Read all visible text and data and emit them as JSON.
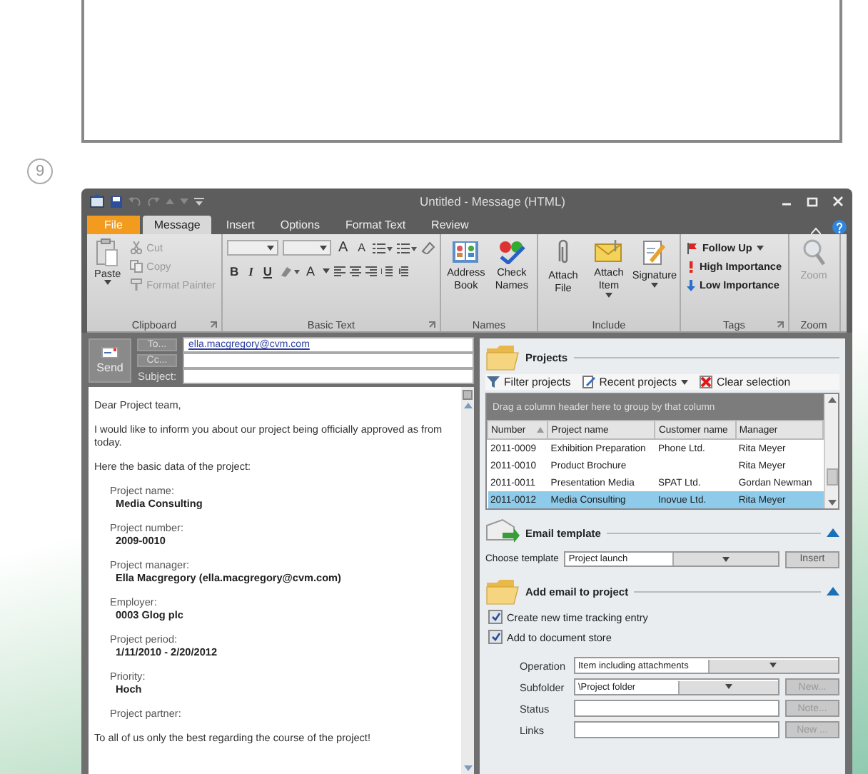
{
  "page": {
    "step_number": "9"
  },
  "window": {
    "title": "Untitled - Message (HTML)"
  },
  "tabs": [
    {
      "label": "File",
      "kind": "file",
      "selected": false
    },
    {
      "label": "Message",
      "kind": "tab",
      "selected": true
    },
    {
      "label": "Insert",
      "kind": "tab",
      "selected": false
    },
    {
      "label": "Options",
      "kind": "tab",
      "selected": false
    },
    {
      "label": "Format Text",
      "kind": "tab",
      "selected": false
    },
    {
      "label": "Review",
      "kind": "tab",
      "selected": false
    }
  ],
  "ribbon": {
    "groups": [
      {
        "kind": "clipboard",
        "label": "Clipboard",
        "launcher": true,
        "paste": "Paste",
        "items": [
          {
            "kind": "cut",
            "label": "Cut",
            "disabled": true
          },
          {
            "kind": "copy",
            "label": "Copy",
            "disabled": true
          },
          {
            "kind": "painter",
            "label": "Format Painter",
            "disabled": true
          }
        ]
      },
      {
        "kind": "basic_text",
        "label": "Basic Text",
        "launcher": true,
        "size_buttons": [
          "A",
          "A"
        ],
        "style_buttons": [
          "B",
          "I",
          "U"
        ],
        "font_color": "A"
      },
      {
        "kind": "large",
        "label": "Names",
        "launcher": false,
        "buttons": [
          {
            "kind": "addressbook",
            "label": "Address Book",
            "menu": false,
            "disabled": false
          },
          {
            "kind": "checknames",
            "label": "Check Names",
            "menu": false,
            "disabled": false
          }
        ]
      },
      {
        "kind": "large",
        "label": "Include",
        "launcher": false,
        "buttons": [
          {
            "kind": "attachfile",
            "label": "Attach File",
            "menu": false,
            "disabled": false
          },
          {
            "kind": "attachitem",
            "label": "Attach Item",
            "menu": true,
            "disabled": false
          },
          {
            "kind": "signature",
            "label": "Signature",
            "menu": true,
            "disabled": false
          }
        ]
      },
      {
        "kind": "tags",
        "label": "Tags",
        "launcher": true,
        "items": [
          {
            "kind": "followup",
            "label": "Follow Up",
            "menu": true
          },
          {
            "kind": "high",
            "label": "High Importance",
            "menu": false
          },
          {
            "kind": "low",
            "label": "Low Importance",
            "menu": false
          }
        ]
      },
      {
        "kind": "large",
        "label": "Zoom",
        "launcher": false,
        "buttons": [
          {
            "kind": "zoom",
            "label": "Zoom",
            "menu": false,
            "disabled": true
          }
        ]
      }
    ]
  },
  "compose": {
    "send": "Send",
    "to_button": "To...",
    "to_value": "ella.macgregory@cvm.com",
    "cc_button": "Cc...",
    "subject_label": "Subject:"
  },
  "body": {
    "paragraphs": [
      {
        "kind": "text",
        "text": "Dear Project team,"
      },
      {
        "kind": "text",
        "text": "I would like to inform you about our project being officially approved as from today."
      },
      {
        "kind": "text",
        "text": "Here the basic data of the project:"
      },
      {
        "kind": "field",
        "label": "Project name:",
        "value": "Media Consulting"
      },
      {
        "kind": "field",
        "label": "Project number:",
        "value": "2009-0010"
      },
      {
        "kind": "field",
        "label": "Project manager:",
        "value": "Ella Macgregory (ella.macgregory@cvm.com)"
      },
      {
        "kind": "field",
        "label": "Employer:",
        "value": "0003 Glog plc"
      },
      {
        "kind": "field",
        "label": "Project period:",
        "value": "1/11/2010 - 2/20/2012"
      },
      {
        "kind": "field",
        "label": "Priority:",
        "value": "Hoch"
      },
      {
        "kind": "field",
        "label": "Project partner:"
      },
      {
        "kind": "text",
        "text": "To all of us only the best regarding the course of the project!"
      }
    ]
  },
  "projects": {
    "title": "Projects",
    "toolbar": [
      {
        "kind": "filter",
        "label": "Filter projects",
        "menu": false
      },
      {
        "kind": "recent",
        "label": "Recent projects",
        "menu": true
      },
      {
        "kind": "clear",
        "label": "Clear selection",
        "menu": false
      }
    ],
    "group_hint": "Drag a column header here to group by that column",
    "columns": [
      {
        "label": "Number",
        "sorted": true
      },
      {
        "label": "Project name",
        "sorted": false
      },
      {
        "label": "Customer name",
        "sorted": false
      },
      {
        "label": "Manager",
        "sorted": false
      }
    ],
    "rows": [
      {
        "cells": [
          "2011-0009",
          "Exhibition Preparation",
          "Phone Ltd.",
          "Rita Meyer"
        ],
        "selected": false
      },
      {
        "cells": [
          "2011-0010",
          "Product Brochure",
          "",
          "Rita Meyer"
        ],
        "selected": false
      },
      {
        "cells": [
          "2011-0011",
          "Presentation Media",
          "SPAT Ltd.",
          "Gordan Newman"
        ],
        "selected": false
      },
      {
        "cells": [
          "2011-0012",
          "Media Consulting",
          "Inovue Ltd.",
          "Rita Meyer"
        ],
        "selected": true
      }
    ]
  },
  "email_template": {
    "title": "Email template",
    "expanded": true,
    "label": "Choose template",
    "value": "Project launch",
    "button": "Insert"
  },
  "add_email": {
    "title": "Add email to project",
    "expanded": true,
    "options": [
      {
        "label": "Create new time tracking entry",
        "checked": true
      },
      {
        "label": "Add to document store",
        "checked": true
      }
    ],
    "fields": [
      {
        "kind": "dropdown",
        "label": "Operation",
        "value": "Item including attachments"
      },
      {
        "kind": "dropdown",
        "label": "Subfolder",
        "value": "\\Project folder",
        "button": {
          "label": "New...",
          "disabled": true
        }
      },
      {
        "kind": "text",
        "label": "Status",
        "button": {
          "label": "Note...",
          "disabled": true
        }
      },
      {
        "kind": "text",
        "label": "Links",
        "button": {
          "label": "New ...",
          "disabled": true
        }
      }
    ]
  }
}
